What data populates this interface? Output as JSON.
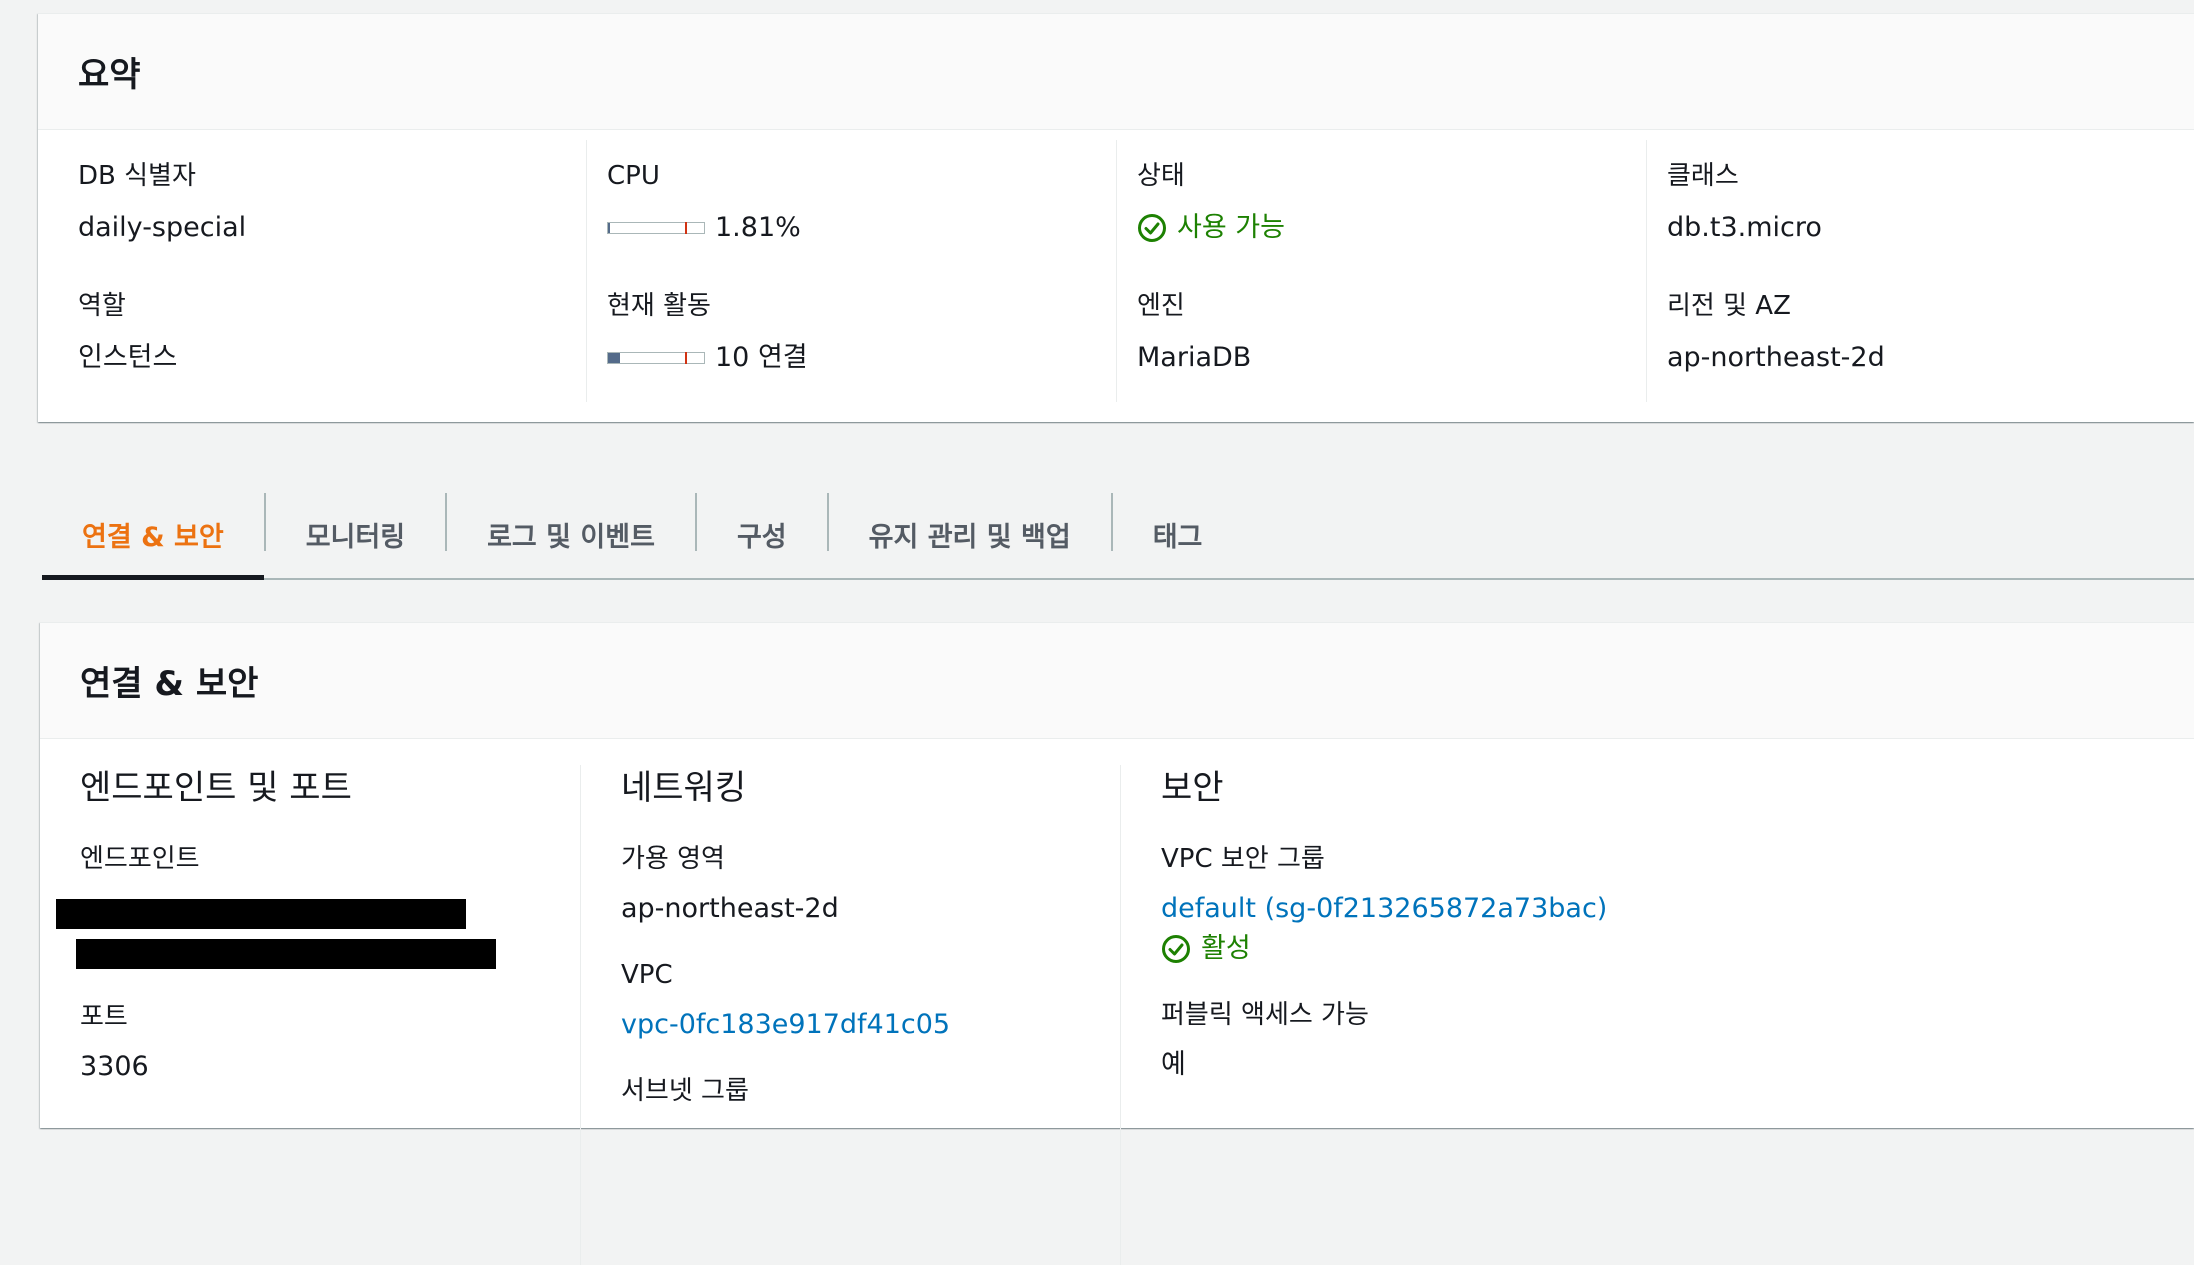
{
  "summary": {
    "title": "요약",
    "db_identifier": {
      "label": "DB 식별자",
      "value": "daily-special"
    },
    "role": {
      "label": "역할",
      "value": "인스턴스"
    },
    "cpu": {
      "label": "CPU",
      "value": "1.81%",
      "level_fraction": 0.0181
    },
    "activity": {
      "label": "현재 활동",
      "value": "10 연결",
      "level_fraction": 0.12
    },
    "status": {
      "label": "상태",
      "value": "사용 가능",
      "icon": "check-circle-icon",
      "color": "#1d8102"
    },
    "engine": {
      "label": "엔진",
      "value": "MariaDB"
    },
    "class": {
      "label": "클래스",
      "value": "db.t3.micro"
    },
    "region_az": {
      "label": "리전 및 AZ",
      "value": "ap-northeast-2d"
    }
  },
  "tabs": [
    {
      "label": "연결 & 보안",
      "active": true
    },
    {
      "label": "모니터링",
      "active": false
    },
    {
      "label": "로그 및 이벤트",
      "active": false
    },
    {
      "label": "구성",
      "active": false
    },
    {
      "label": "유지 관리 및 백업",
      "active": false
    },
    {
      "label": "태그",
      "active": false
    }
  ],
  "connectivity": {
    "title": "연결 & 보안",
    "endpoint_port": {
      "title": "엔드포인트 및 포트",
      "endpoint_label": "엔드포인트",
      "port_label": "포트",
      "port_value": "3306"
    },
    "networking": {
      "title": "네트워킹",
      "az_label": "가용 영역",
      "az_value": "ap-northeast-2d",
      "vpc_label": "VPC",
      "vpc_value": "vpc-0fc183e917df41c05",
      "subnet_label": "서브넷 그룹"
    },
    "security": {
      "title": "보안",
      "sg_label": "VPC 보안 그룹",
      "sg_value": "default (sg-0f213265872a73bac)",
      "sg_status": "활성",
      "public_label": "퍼블릭 액세스 가능",
      "public_value": "예"
    }
  },
  "colors": {
    "accent": "#ec7211",
    "link": "#0073bb",
    "success": "#1d8102",
    "meter_fill": "#546b8a",
    "meter_mark": "#d13212"
  }
}
